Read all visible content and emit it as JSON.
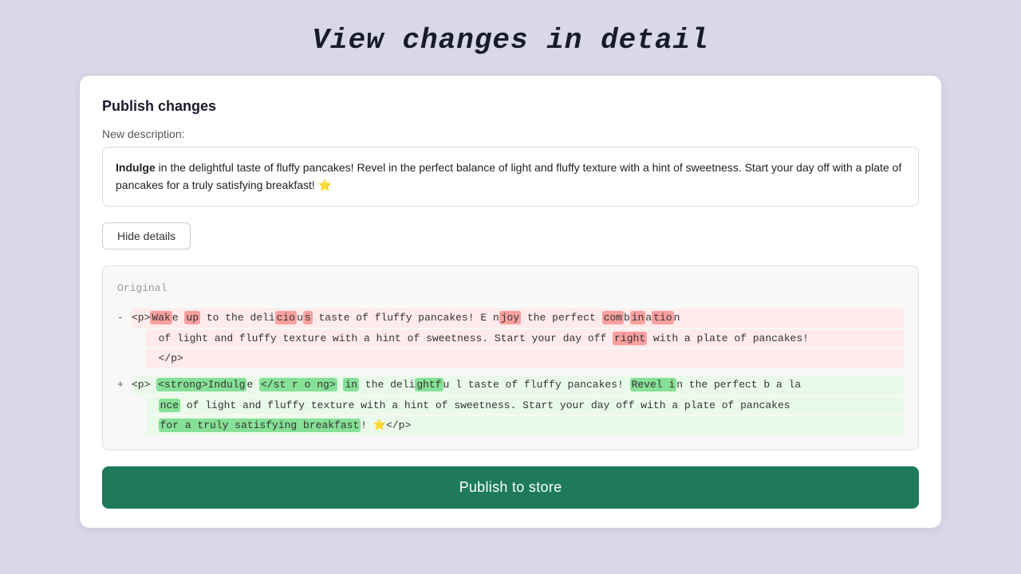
{
  "page": {
    "title": "View changes in detail"
  },
  "card": {
    "title": "Publish changes",
    "description_label": "New description:",
    "description_text_bold": "Indulge",
    "description_text_rest": " in the delightful taste of fluffy pancakes! Revel in the perfect balance of light and fluffy texture with a hint of sweetness. Start your day off with a plate of pancakes for a truly satisfying breakfast! ⭐",
    "hide_details_label": "Hide details",
    "diff_label": "Original",
    "publish_label": "Publish to store"
  }
}
